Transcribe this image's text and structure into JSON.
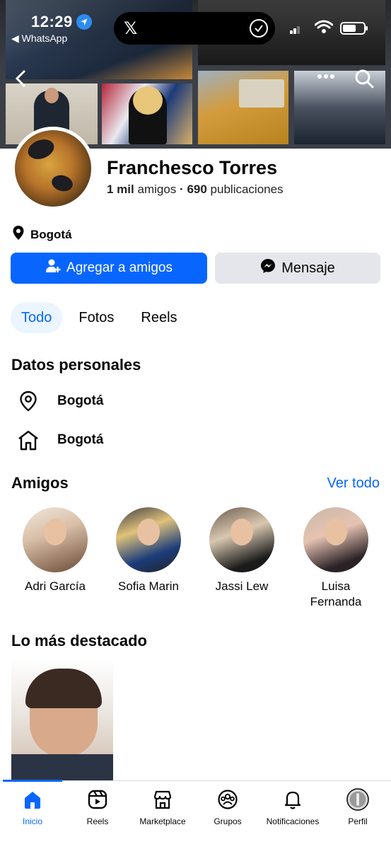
{
  "status_bar": {
    "time": "12:29",
    "back_app": "◀ WhatsApp",
    "island_icon": "x-logo-icon"
  },
  "profile": {
    "name": "Franchesco Torres",
    "friends_count": "1 mil",
    "friends_label": "amigos",
    "separator": "·",
    "posts_count": "690",
    "posts_label": "publicaciones",
    "location": "Bogotá"
  },
  "actions": {
    "add_friend": "Agregar a amigos",
    "message": "Mensaje"
  },
  "tabs": [
    {
      "label": "Todo",
      "active": true
    },
    {
      "label": "Fotos",
      "active": false
    },
    {
      "label": "Reels",
      "active": false
    }
  ],
  "personal_data": {
    "title": "Datos personales",
    "rows": [
      {
        "icon": "location-pin-icon",
        "text": "Bogotá"
      },
      {
        "icon": "home-icon",
        "text": "Bogotá"
      }
    ]
  },
  "friends": {
    "title": "Amigos",
    "see_all": "Ver todo",
    "items": [
      {
        "name": "Adri García"
      },
      {
        "name": "Sofia Marin"
      },
      {
        "name": "Jassi Lew"
      },
      {
        "name": "Luisa Fernanda"
      }
    ]
  },
  "highlights": {
    "title": "Lo más destacado"
  },
  "bottom_nav": [
    {
      "label": "Inicio",
      "icon": "home-icon",
      "active": true
    },
    {
      "label": "Reels",
      "icon": "reels-icon",
      "active": false
    },
    {
      "label": "Marketplace",
      "icon": "marketplace-icon",
      "active": false
    },
    {
      "label": "Grupos",
      "icon": "groups-icon",
      "active": false
    },
    {
      "label": "Notificaciones",
      "icon": "bell-icon",
      "active": false
    },
    {
      "label": "Perfil",
      "icon": "profile-avatar-icon",
      "active": false
    }
  ],
  "colors": {
    "accent": "#0866ff",
    "secondary_button": "#e4e6eb",
    "active_tab_bg": "#ebf5ff"
  }
}
